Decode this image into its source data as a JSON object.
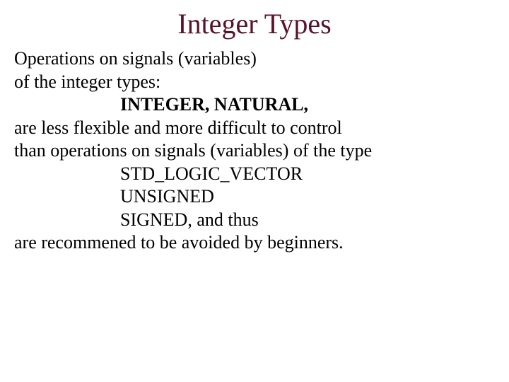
{
  "title": "Integer Types",
  "body": {
    "line1": "Operations on signals (variables)",
    "line2": "of the integer types:",
    "line3": "INTEGER, NATURAL,",
    "line4": "are less flexible and more difficult to control",
    "line5": "than operations on signals (variables) of the type",
    "line6": "STD_LOGIC_VECTOR",
    "line7": "UNSIGNED",
    "line8": "SIGNED, and thus",
    "line9": "are recommened to be avoided by beginners."
  }
}
